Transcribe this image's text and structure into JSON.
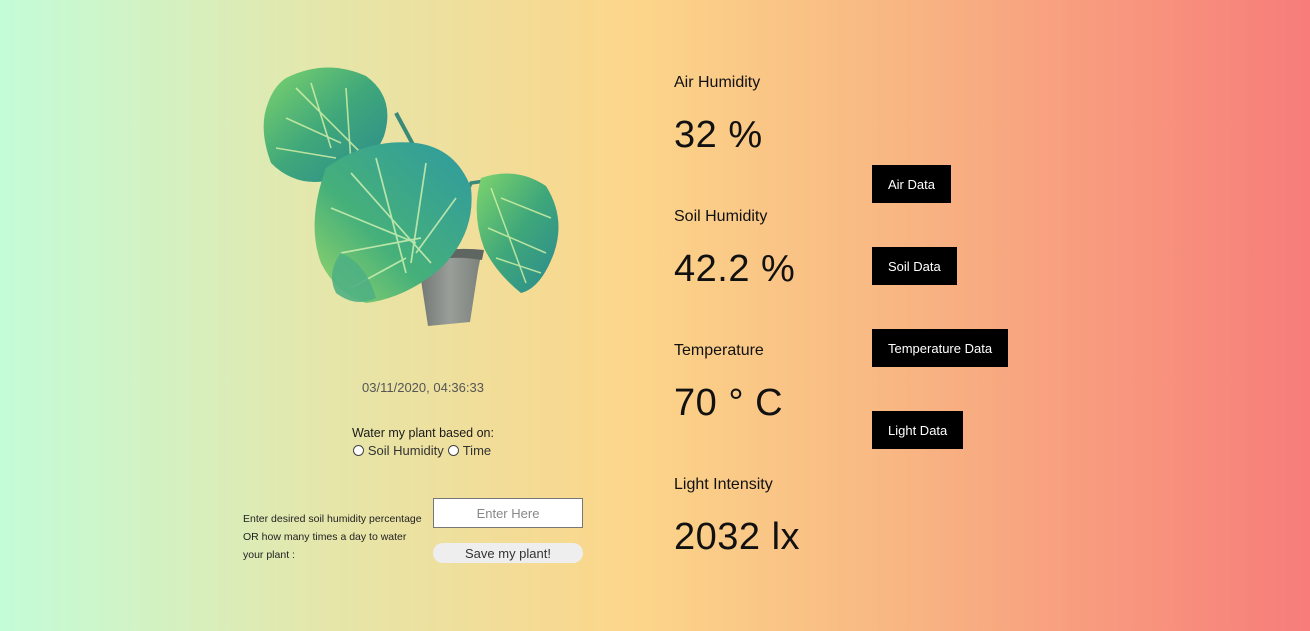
{
  "plant": {
    "timestamp": "03/11/2020, 04:36:33",
    "water_based_on": {
      "title": "Water my plant based on:",
      "options": [
        "Soil Humidity",
        "Time"
      ]
    },
    "desired": {
      "label": "Enter desired soil humidity percentage OR how many times a day to water your plant :",
      "placeholder": "Enter Here",
      "value": "",
      "save_label": "Save my plant!"
    }
  },
  "metrics": {
    "air": {
      "label": "Air Humidity",
      "value": "32 %"
    },
    "soil": {
      "label": "Soil Humidity",
      "value": "42.2 %"
    },
    "temperature": {
      "label": "Temperature",
      "value": "70 ° C"
    },
    "light": {
      "label": "Light Intensity",
      "value": "2032 lx"
    }
  },
  "buttons": {
    "air": "Air Data",
    "soil": "Soil Data",
    "temperature": "Temperature Data",
    "light": "Light Data"
  }
}
